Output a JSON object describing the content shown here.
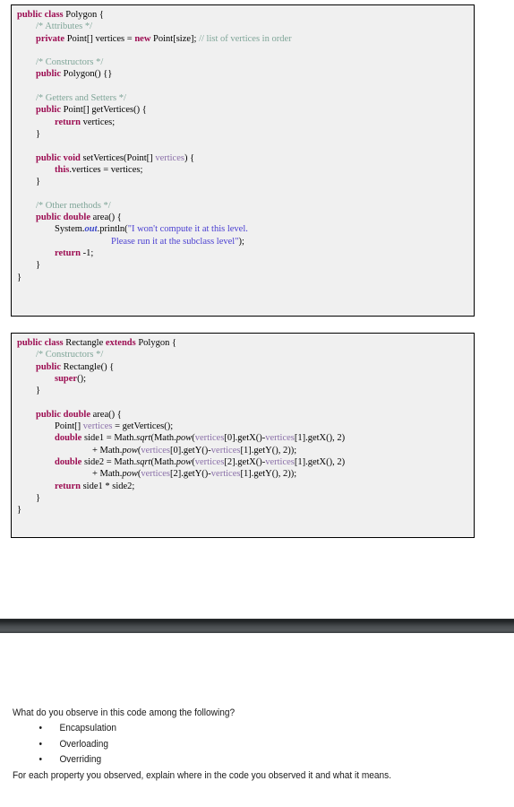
{
  "document": {
    "type": "exam-question-slide",
    "background_color": "#ffffff",
    "code_background_color": "#f0f0f0",
    "code_border_color": "#000000",
    "divider_bar_color": "#3c4043"
  },
  "colors": {
    "keyword": "#9c0d52",
    "comment": "#7fa598",
    "variable_blue": "#5b49c8",
    "variable_mauve": "#8a6fa8",
    "string": "#4a3fd1",
    "field": "#3a46c8",
    "plain": "#000000"
  },
  "code_blocks": [
    {
      "name": "Polygon",
      "lines": [
        [
          {
            "t": "public class",
            "c": "kw"
          },
          {
            "t": " Polygon {",
            "c": "plain"
          }
        ],
        [
          {
            "t": "        ",
            "c": "plain"
          },
          {
            "t": "/* Attributes */",
            "c": "cmt"
          }
        ],
        [
          {
            "t": "        ",
            "c": "plain"
          },
          {
            "t": "private",
            "c": "kw"
          },
          {
            "t": " Point[] ",
            "c": "plain"
          },
          {
            "t": "vertices",
            "c": "var"
          },
          {
            "t": " = ",
            "c": "plain"
          },
          {
            "t": "new",
            "c": "kw"
          },
          {
            "t": " Point[",
            "c": "plain"
          },
          {
            "t": "size",
            "c": "var"
          },
          {
            "t": "]; ",
            "c": "plain"
          },
          {
            "t": "// list of vertices in order",
            "c": "cmt"
          }
        ],
        [],
        [
          {
            "t": "        ",
            "c": "plain"
          },
          {
            "t": "/* Constructors */",
            "c": "cmt"
          }
        ],
        [
          {
            "t": "        ",
            "c": "plain"
          },
          {
            "t": "public",
            "c": "kw"
          },
          {
            "t": " Polygon() {}",
            "c": "plain"
          }
        ],
        [],
        [
          {
            "t": "        ",
            "c": "plain"
          },
          {
            "t": "/* Getters and Setters */",
            "c": "cmt"
          }
        ],
        [
          {
            "t": "        ",
            "c": "plain"
          },
          {
            "t": "public",
            "c": "kw"
          },
          {
            "t": " Point[] getVertices() {",
            "c": "plain"
          }
        ],
        [
          {
            "t": "                ",
            "c": "plain"
          },
          {
            "t": "return",
            "c": "kw"
          },
          {
            "t": " ",
            "c": "plain"
          },
          {
            "t": "vertices",
            "c": "var"
          },
          {
            "t": ";",
            "c": "plain"
          }
        ],
        [
          {
            "t": "        }",
            "c": "plain"
          }
        ],
        [],
        [
          {
            "t": "        ",
            "c": "plain"
          },
          {
            "t": "public void",
            "c": "kw"
          },
          {
            "t": " setVertices(Point[] ",
            "c": "plain"
          },
          {
            "t": "vertices",
            "c": "var2"
          },
          {
            "t": ") {",
            "c": "plain"
          }
        ],
        [
          {
            "t": "                ",
            "c": "plain"
          },
          {
            "t": "this",
            "c": "kw"
          },
          {
            "t": ".",
            "c": "plain"
          },
          {
            "t": "vertices",
            "c": "var"
          },
          {
            "t": " = vertices;",
            "c": "plain"
          }
        ],
        [
          {
            "t": "        }",
            "c": "plain"
          }
        ],
        [],
        [
          {
            "t": "        ",
            "c": "plain"
          },
          {
            "t": "/* Other methods */",
            "c": "cmt"
          }
        ],
        [
          {
            "t": "        ",
            "c": "plain"
          },
          {
            "t": "public double",
            "c": "kw"
          },
          {
            "t": " area() {",
            "c": "plain"
          }
        ],
        [
          {
            "t": "                System.",
            "c": "plain"
          },
          {
            "t": "out",
            "c": "field"
          },
          {
            "t": ".println(",
            "c": "plain"
          },
          {
            "t": "\"I won't compute it at this level.",
            "c": "str"
          }
        ],
        [
          {
            "t": "                                        ",
            "c": "plain"
          },
          {
            "t": "Please run it at the subclass level\"",
            "c": "str"
          },
          {
            "t": ");",
            "c": "plain"
          }
        ],
        [
          {
            "t": "                ",
            "c": "plain"
          },
          {
            "t": "return",
            "c": "kw"
          },
          {
            "t": " -1;",
            "c": "plain"
          }
        ],
        [
          {
            "t": "        }",
            "c": "plain"
          }
        ],
        [
          {
            "t": "}",
            "c": "plain"
          }
        ]
      ]
    },
    {
      "name": "Rectangle",
      "lines": [
        [
          {
            "t": "public class",
            "c": "kw"
          },
          {
            "t": " Rectangle ",
            "c": "plain"
          },
          {
            "t": "extends",
            "c": "kw"
          },
          {
            "t": " Polygon {",
            "c": "plain"
          }
        ],
        [
          {
            "t": "        ",
            "c": "plain"
          },
          {
            "t": "/* Constructors */",
            "c": "cmt"
          }
        ],
        [
          {
            "t": "        ",
            "c": "plain"
          },
          {
            "t": "public",
            "c": "kw"
          },
          {
            "t": " Rectangle() {",
            "c": "plain"
          }
        ],
        [
          {
            "t": "                ",
            "c": "plain"
          },
          {
            "t": "super",
            "c": "kw"
          },
          {
            "t": "();",
            "c": "plain"
          }
        ],
        [
          {
            "t": "        }",
            "c": "plain"
          }
        ],
        [],
        [
          {
            "t": "        ",
            "c": "plain"
          },
          {
            "t": "public double",
            "c": "kw"
          },
          {
            "t": " area() {",
            "c": "plain"
          }
        ],
        [
          {
            "t": "                Point[] ",
            "c": "plain"
          },
          {
            "t": "vertices",
            "c": "var2"
          },
          {
            "t": " = getVertices();",
            "c": "plain"
          }
        ],
        [
          {
            "t": "                ",
            "c": "plain"
          },
          {
            "t": "double",
            "c": "kw"
          },
          {
            "t": " side1 = Math.",
            "c": "plain"
          },
          {
            "t": "sqrt",
            "c": "ital"
          },
          {
            "t": "(Math.",
            "c": "plain"
          },
          {
            "t": "pow",
            "c": "ital"
          },
          {
            "t": "(",
            "c": "plain"
          },
          {
            "t": "vertices",
            "c": "var2"
          },
          {
            "t": "[0].getX()-",
            "c": "plain"
          },
          {
            "t": "vertices",
            "c": "var2"
          },
          {
            "t": "[1].getX(), 2)",
            "c": "plain"
          }
        ],
        [
          {
            "t": "                                + Math.",
            "c": "plain"
          },
          {
            "t": "pow",
            "c": "ital"
          },
          {
            "t": "(",
            "c": "plain"
          },
          {
            "t": "vertices",
            "c": "var2"
          },
          {
            "t": "[0].getY()-",
            "c": "plain"
          },
          {
            "t": "vertices",
            "c": "var2"
          },
          {
            "t": "[1].getY(), 2));",
            "c": "plain"
          }
        ],
        [
          {
            "t": "                ",
            "c": "plain"
          },
          {
            "t": "double",
            "c": "kw"
          },
          {
            "t": " side2 = Math.",
            "c": "plain"
          },
          {
            "t": "sqrt",
            "c": "ital"
          },
          {
            "t": "(Math.",
            "c": "plain"
          },
          {
            "t": "pow",
            "c": "ital"
          },
          {
            "t": "(",
            "c": "plain"
          },
          {
            "t": "vertices",
            "c": "var2"
          },
          {
            "t": "[2].getX()-",
            "c": "plain"
          },
          {
            "t": "vertices",
            "c": "var2"
          },
          {
            "t": "[1].getX(), 2)",
            "c": "plain"
          }
        ],
        [
          {
            "t": "                                + Math.",
            "c": "plain"
          },
          {
            "t": "pow",
            "c": "ital"
          },
          {
            "t": "(",
            "c": "plain"
          },
          {
            "t": "vertices",
            "c": "var2"
          },
          {
            "t": "[2].getY()-",
            "c": "plain"
          },
          {
            "t": "vertices",
            "c": "var2"
          },
          {
            "t": "[1].getY(), 2));",
            "c": "plain"
          }
        ],
        [
          {
            "t": "                ",
            "c": "plain"
          },
          {
            "t": "return",
            "c": "kw"
          },
          {
            "t": " side1 * side2;",
            "c": "plain"
          }
        ],
        [
          {
            "t": "        }",
            "c": "plain"
          }
        ],
        [
          {
            "t": "}",
            "c": "plain"
          }
        ]
      ]
    }
  ],
  "question": {
    "prompt": "What do you observe in this code among the following?",
    "bullet_glyph": "•",
    "options": [
      "Encapsulation",
      "Overloading",
      "Overriding"
    ],
    "footer": "For each property you observed, explain where in the code you observed it and what it means."
  }
}
